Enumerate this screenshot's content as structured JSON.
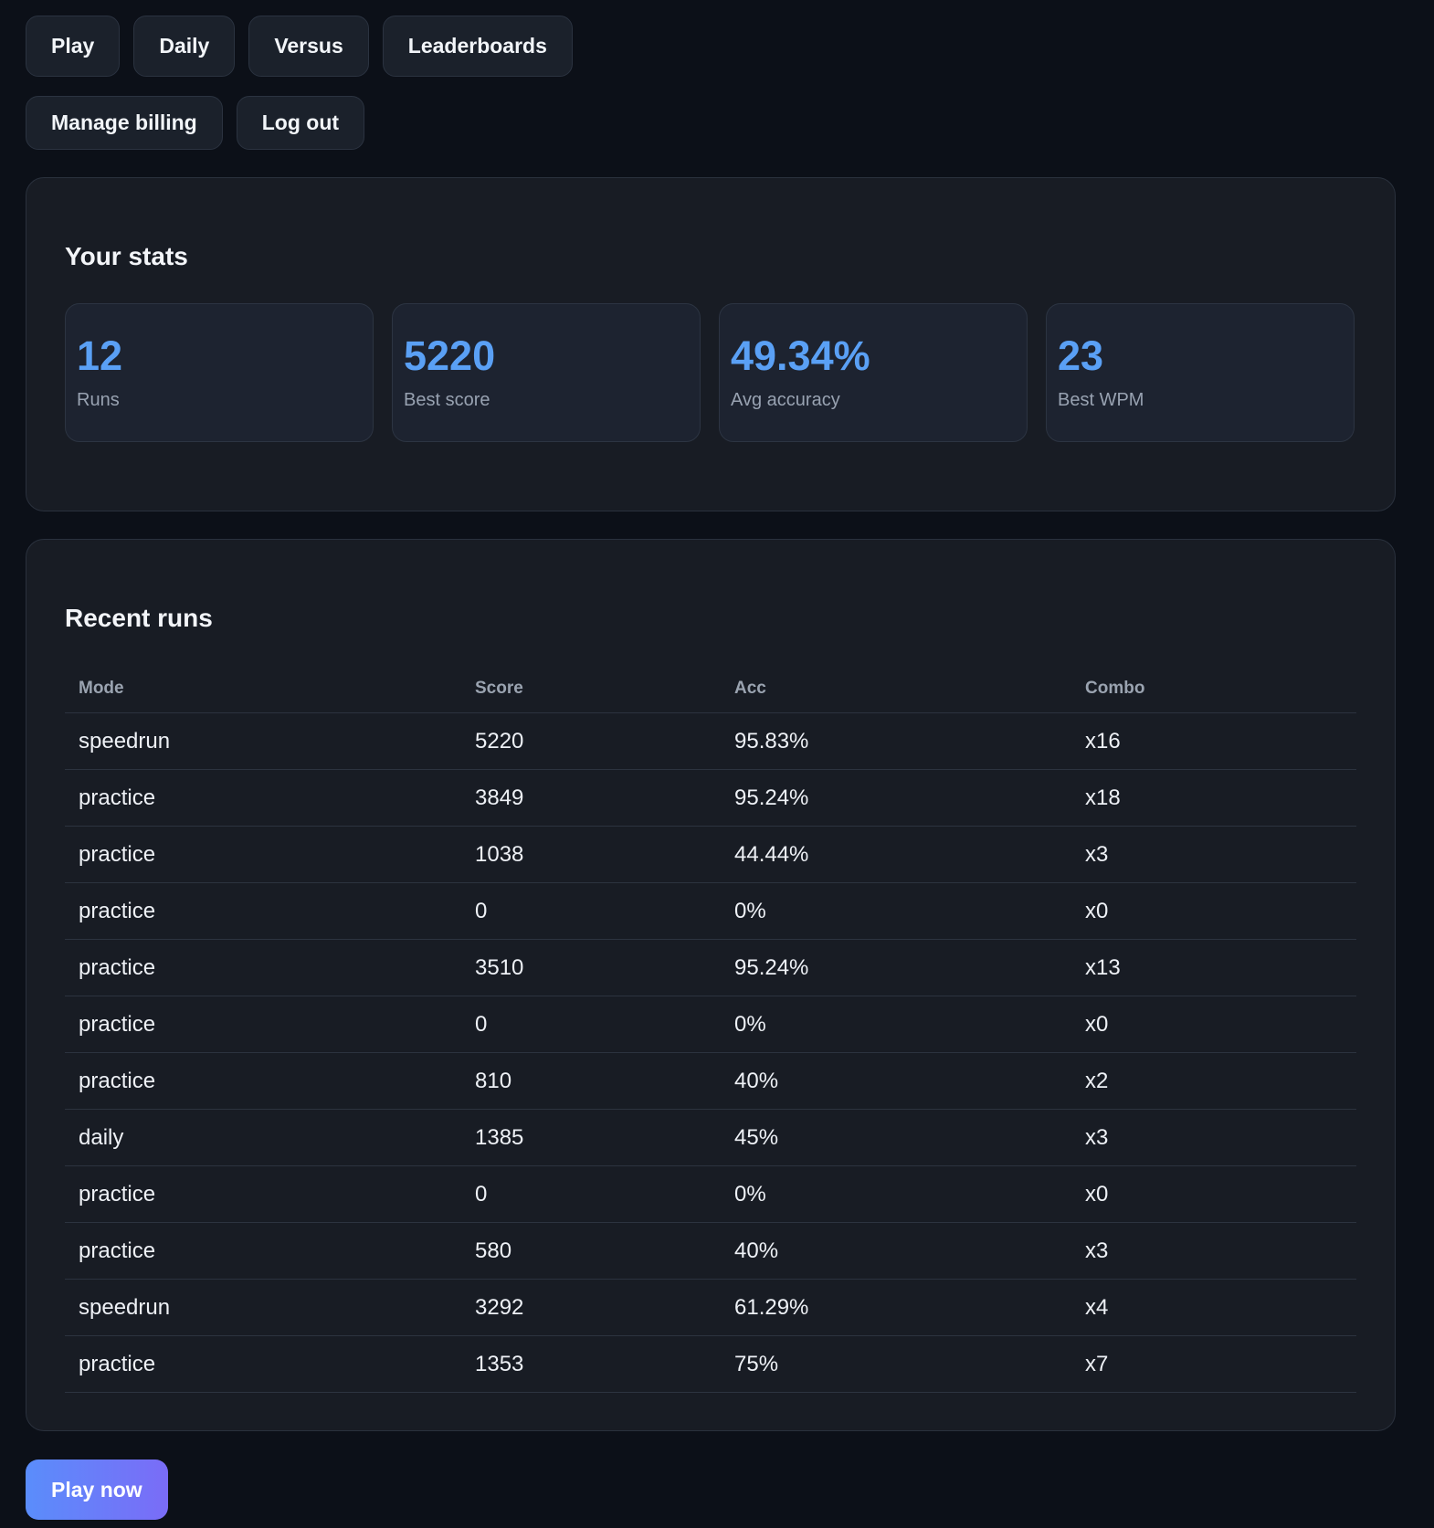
{
  "nav": {
    "primary": [
      {
        "label": "Play"
      },
      {
        "label": "Daily"
      },
      {
        "label": "Versus"
      },
      {
        "label": "Leaderboards"
      }
    ],
    "account": [
      {
        "label": "Manage billing"
      },
      {
        "label": "Log out"
      }
    ]
  },
  "stats": {
    "title": "Your stats",
    "cards": [
      {
        "value": "12",
        "label": "Runs"
      },
      {
        "value": "5220",
        "label": "Best score"
      },
      {
        "value": "49.34%",
        "label": "Avg accuracy"
      },
      {
        "value": "23",
        "label": "Best WPM"
      }
    ]
  },
  "runs": {
    "title": "Recent runs",
    "columns": [
      "Mode",
      "Score",
      "Acc",
      "Combo"
    ],
    "rows": [
      [
        "speedrun",
        "5220",
        "95.83%",
        "x16"
      ],
      [
        "practice",
        "3849",
        "95.24%",
        "x18"
      ],
      [
        "practice",
        "1038",
        "44.44%",
        "x3"
      ],
      [
        "practice",
        "0",
        "0%",
        "x0"
      ],
      [
        "practice",
        "3510",
        "95.24%",
        "x13"
      ],
      [
        "practice",
        "0",
        "0%",
        "x0"
      ],
      [
        "practice",
        "810",
        "40%",
        "x2"
      ],
      [
        "daily",
        "1385",
        "45%",
        "x3"
      ],
      [
        "practice",
        "0",
        "0%",
        "x0"
      ],
      [
        "practice",
        "580",
        "40%",
        "x3"
      ],
      [
        "speedrun",
        "3292",
        "61.29%",
        "x4"
      ],
      [
        "practice",
        "1353",
        "75%",
        "x7"
      ]
    ]
  },
  "cta": {
    "label": "Play now"
  },
  "colors": {
    "accent": "#5aa0f5",
    "background": "#0c1018",
    "panel": "#181c24",
    "cta_gradient_start": "#5a8dfb",
    "cta_gradient_end": "#7a6cf7"
  }
}
